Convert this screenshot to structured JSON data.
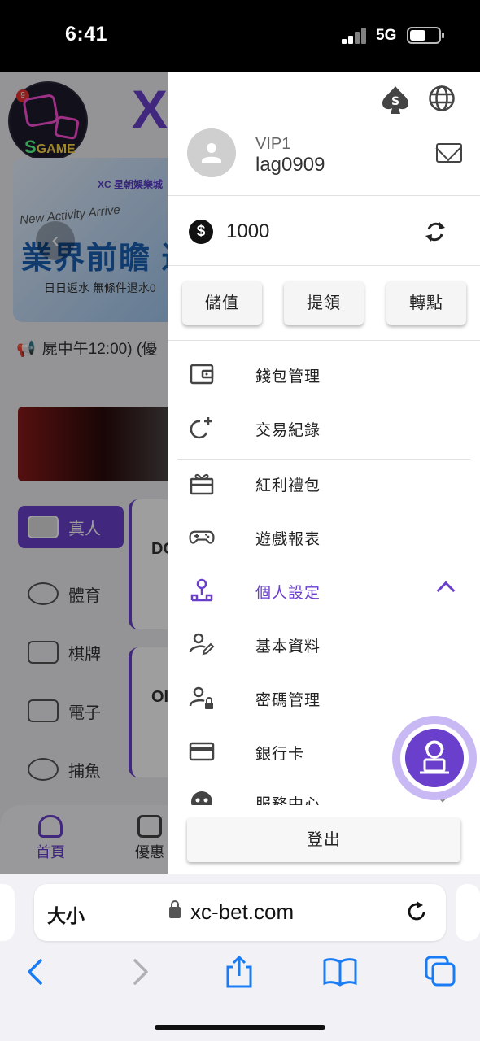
{
  "status_bar": {
    "time": "6:41",
    "network": "5G"
  },
  "background": {
    "game_badge": {
      "count": "9",
      "label_s": "S",
      "label": "GAME"
    },
    "banner": {
      "logo": "XC 星朝娛樂城",
      "subtitle": "New Activity Arrive",
      "title": "業界前瞻 返",
      "text": "日日返水 無條件退水0"
    },
    "marquee": "屍中午12:00) (優",
    "categories": [
      "真人",
      "體育",
      "棋牌",
      "電子",
      "捕魚"
    ],
    "game_cards": [
      "DC",
      "OI"
    ],
    "bottom_nav": [
      "首頁",
      "優惠"
    ]
  },
  "drawer": {
    "user": {
      "vip": "VIP1",
      "username": "lag0909"
    },
    "balance": {
      "currency_symbol": "$",
      "amount": "1000"
    },
    "actions": [
      "儲值",
      "提領",
      "轉點"
    ],
    "menu": [
      {
        "label": "錢包管理",
        "icon": "wallet-icon"
      },
      {
        "label": "交易紀錄",
        "icon": "history-plus-icon"
      },
      {
        "label": "紅利禮包",
        "icon": "gift-box-icon"
      },
      {
        "label": "遊戲報表",
        "icon": "gamepad-icon"
      },
      {
        "label": "個人設定",
        "icon": "person-settings-icon"
      },
      {
        "label": "基本資料",
        "icon": "user-edit-icon"
      },
      {
        "label": "密碼管理",
        "icon": "user-lock-icon"
      },
      {
        "label": "銀行卡",
        "icon": "credit-card-icon"
      },
      {
        "label": "服務中心",
        "icon": "support-icon"
      }
    ],
    "logout": "登出",
    "accent_color": "#6a3fcb"
  },
  "browser": {
    "text_size": "大小",
    "url": "xc-bet.com"
  }
}
